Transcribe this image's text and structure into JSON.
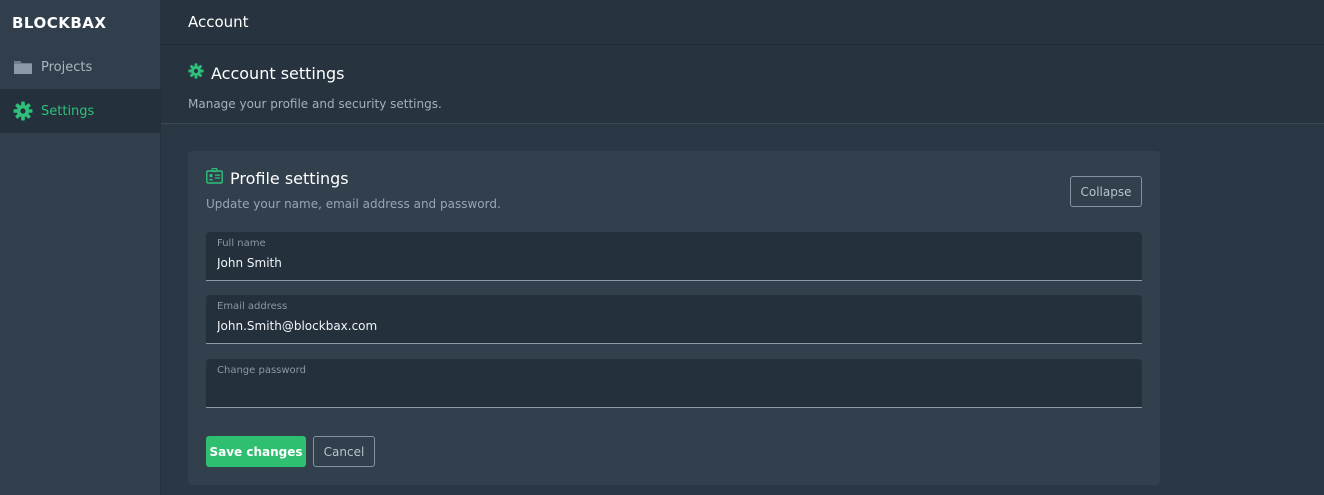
{
  "brand": {
    "logo_text": "BLOCKBAX"
  },
  "sidebar": {
    "items": [
      {
        "label": "Projects",
        "icon": "folder-icon"
      },
      {
        "label": "Settings",
        "icon": "gear-icon",
        "active": true
      }
    ]
  },
  "topbar": {
    "title": "Account"
  },
  "header": {
    "title": "Account settings",
    "subtitle": "Manage your profile and security settings."
  },
  "profile_card": {
    "title": "Profile settings",
    "subtitle": "Update your name, email address and password.",
    "collapse_label": "Collapse",
    "fields": [
      {
        "label": "Full name",
        "value": "John Smith"
      },
      {
        "label": "Email address",
        "value": "John.Smith@blockbax.com"
      },
      {
        "label": "Change password",
        "value": ""
      }
    ],
    "save_label": "Save changes",
    "cancel_label": "Cancel"
  },
  "colors": {
    "accent": "#2fbf71",
    "sidebar_bg": "#313f4c",
    "content_bg": "#2a3744",
    "card_bg": "#323f4c"
  }
}
